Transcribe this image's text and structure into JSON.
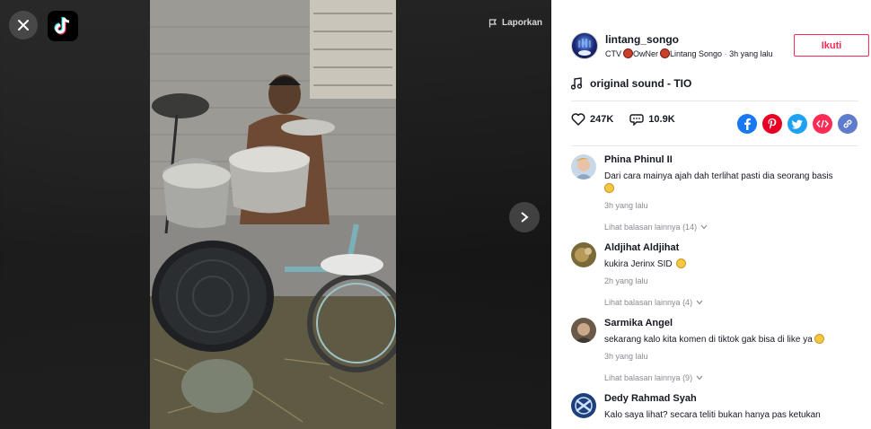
{
  "player": {
    "report_label": "Laporkan"
  },
  "author": {
    "username": "lintang_songo",
    "nickname": "CTV",
    "nickname_2": "OwNer",
    "nickname_3": "Lintang Songo",
    "separator": " · ",
    "time": "3h yang lalu",
    "follow_label": "Ikuti"
  },
  "music": {
    "title": "original sound - TIO"
  },
  "stats": {
    "likes": "247K",
    "comments": "10.9K"
  },
  "share_icons": [
    "facebook-icon",
    "pinterest-icon",
    "twitter-icon",
    "embed-icon",
    "link-icon"
  ],
  "colors": {
    "accent": "#fe2c55",
    "facebook": "#1877f2",
    "pinterest": "#e60023",
    "twitter": "#1da1f2",
    "embed": "#fe2c55",
    "link": "#5d7dcc"
  },
  "comments": [
    {
      "name": "Phina Phinul II",
      "text": "Dari cara mainya ajah dah terlihat pasti dia seorang basis",
      "time": "3h yang lalu",
      "more": "Lihat balasan lainnya (14)"
    },
    {
      "name": "Aldjihat Aldjihat",
      "text": "kukira Jerinx SID",
      "time": "2h yang lalu",
      "more": "Lihat balasan lainnya (4)"
    },
    {
      "name": "Sarmika Angel",
      "text": "sekarang kalo kita komen di tiktok gak bisa di like ya",
      "time": "3h yang lalu",
      "more": "Lihat balasan lainnya (9)"
    },
    {
      "name": "Dedy Rahmad Syah",
      "text": "Kalo saya lihat? secara teliti bukan hanya pas ketukan"
    }
  ]
}
